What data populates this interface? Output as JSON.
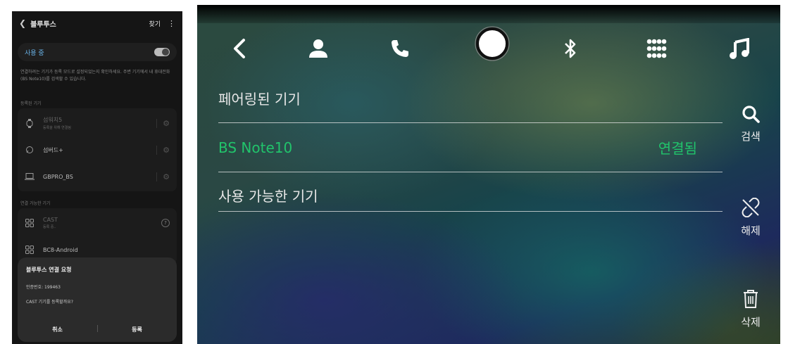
{
  "phone": {
    "header": {
      "back_icon": "chevron-left-icon",
      "title": "블루투스",
      "find": "찾기",
      "more": "⋮"
    },
    "toggle": {
      "label": "사용 중",
      "state": "on"
    },
    "description": "연결하려는 기기가 등록 모드로 설정되었는지 확인하세요. 주변 기기에서 내 휴대전화(BS Note10)를 검색할 수 있습니다.",
    "registered_section": "등록된 기기",
    "registered": [
      {
        "name": "섬워치5",
        "sub": "등록을 위해 연결됨",
        "icon": "watch-icon"
      },
      {
        "name": "섬버드+",
        "sub": "",
        "icon": "earbuds-icon"
      },
      {
        "name": "GBPRO_BS",
        "sub": "",
        "icon": "laptop-icon"
      }
    ],
    "available_section": "연결 가능한 기기",
    "available": [
      {
        "name": "CAST",
        "sub": "등록 중..",
        "icon": "grid-icon"
      },
      {
        "name": "BC8-Android",
        "sub": "",
        "icon": "grid-icon"
      }
    ],
    "dialog": {
      "title": "블루투스 연결 요청",
      "pin": "인증번호: 199463",
      "question": "CAST 기기를 등록할까요?",
      "cancel": "취소",
      "register": "등록"
    }
  },
  "car": {
    "nav_icons": [
      "back-icon",
      "contacts-icon",
      "phone-icon",
      "home-circle-icon",
      "bluetooth-icon",
      "apps-grid-icon",
      "music-icon"
    ],
    "rows": {
      "paired_header": "페어링된 기기",
      "device_name": "BS Note10",
      "device_status": "연결됨",
      "available_header": "사용 가능한 기기"
    },
    "side": {
      "search": "검색",
      "unpair": "해제",
      "delete": "삭제"
    },
    "colors": {
      "connected": "#21c46b",
      "text": "#e8e8e8"
    }
  }
}
